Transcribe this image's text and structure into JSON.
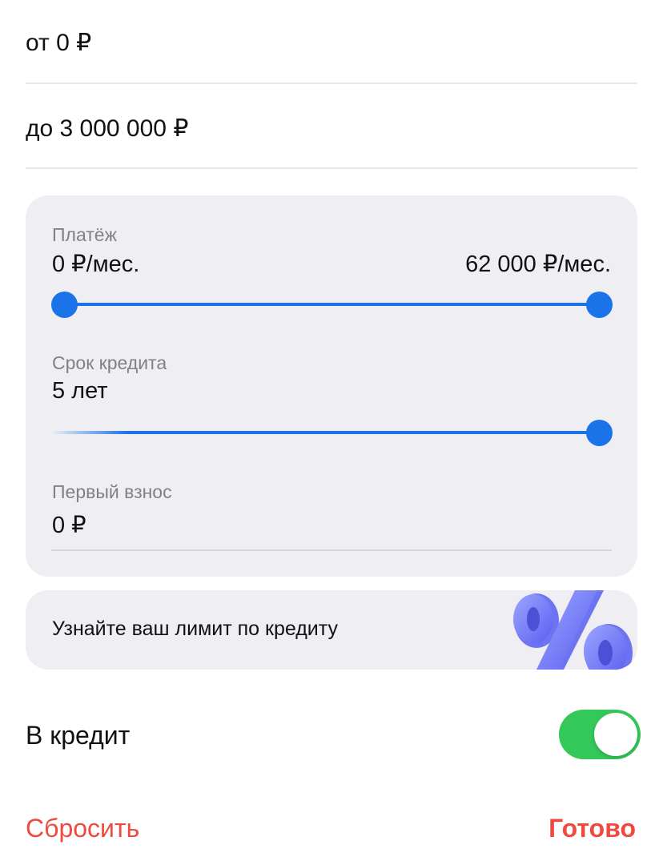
{
  "price": {
    "from_value": "от 0 ₽",
    "to_value": "до 3 000 000 ₽"
  },
  "payment": {
    "label": "Платёж",
    "min_value": "0 ₽/мес.",
    "max_value": "62 000 ₽/мес.",
    "range_fraction": [
      0,
      1
    ]
  },
  "term": {
    "label": "Срок кредита",
    "value": "5 лет",
    "fraction": 1
  },
  "down_payment": {
    "label": "Первый взнос",
    "value": "0 ₽"
  },
  "promo": {
    "text": "Узнайте ваш лимит по кредиту",
    "icon": "percent-icon"
  },
  "credit": {
    "label": "В кредит",
    "enabled": true
  },
  "footer": {
    "reset_label": "Сбросить",
    "done_label": "Готово"
  },
  "colors": {
    "accent": "#1a73e8",
    "toggle_on": "#34c759",
    "action": "#f04a3f",
    "panel": "#efeff3"
  }
}
